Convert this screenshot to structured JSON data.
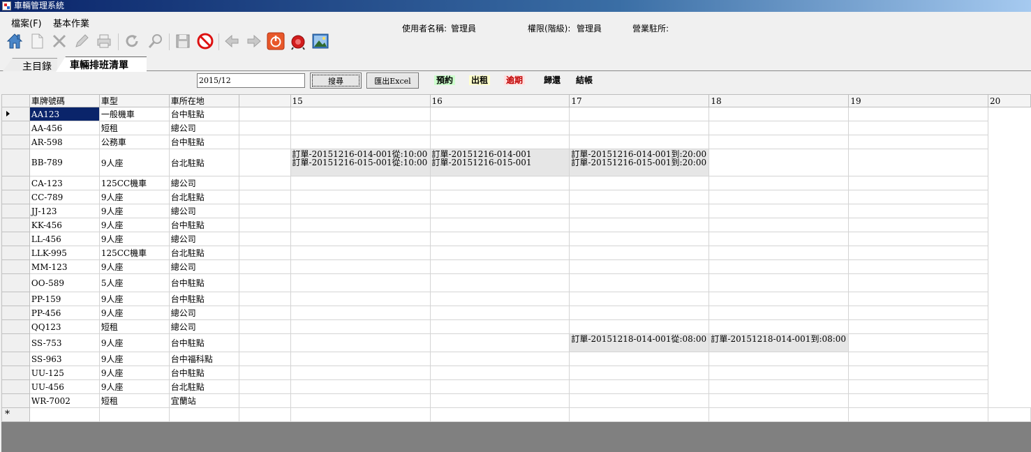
{
  "window": {
    "title": "車輛管理系統"
  },
  "menu": {
    "file": "檔案(F)",
    "basic": "基本作業"
  },
  "user_info": {
    "user_label": "使用者名稱:",
    "user_value": "管理員",
    "rights_label": "權限(階級):",
    "rights_value": "管理員",
    "office_label": "營業駐所:",
    "office_value": ""
  },
  "toolbar": {
    "icons": [
      "home-icon",
      "new-document-icon",
      "delete-icon",
      "edit-icon",
      "print-icon",
      "refresh-icon",
      "search-icon",
      "save-icon",
      "cancel-icon",
      "back-icon",
      "forward-icon",
      "power-icon",
      "alarm-icon",
      "image-icon"
    ]
  },
  "tabs": {
    "main": "主目錄",
    "schedule": "車輛排班清單"
  },
  "search": {
    "value": "2015/12",
    "search_button": "搜尋",
    "excel_button": "匯出Excel"
  },
  "legend": [
    {
      "label": "預約",
      "color": "#ccffcc",
      "text": "#000000"
    },
    {
      "label": "出租",
      "color": "#ffffcc",
      "text": "#000000"
    },
    {
      "label": "逾期",
      "color": "#ffe0e0",
      "text": "#c00000"
    },
    {
      "label": "歸還",
      "color": "#f0f0f0",
      "text": "#000000"
    },
    {
      "label": "結帳",
      "color": "#f0f0f0",
      "text": "#000000"
    }
  ],
  "grid": {
    "headers": [
      "車牌號碼",
      "車型",
      "車所在地",
      "",
      "15",
      "16",
      "17",
      "18",
      "19",
      "20"
    ],
    "rows": [
      {
        "plate": "AA123",
        "type": "一般機車",
        "loc": "台中駐點",
        "selected": true
      },
      {
        "plate": "AA-456",
        "type": "短租",
        "loc": "總公司"
      },
      {
        "plate": "AR-598",
        "type": "公務車",
        "loc": "台中駐點"
      },
      {
        "plate": "BB-789",
        "type": "9人座",
        "loc": "台北駐點",
        "tall": true,
        "d16": [
          "訂單-20151216-014-001從:10:00",
          "訂單-20151216-015-001從:10:00"
        ],
        "d17": [
          "訂單-20151216-014-001",
          "訂單-20151216-015-001"
        ],
        "d18": [
          "訂單-20151216-014-001到:20:00",
          "訂單-20151216-015-001到:20:00"
        ]
      },
      {
        "plate": "CA-123",
        "type": "125CC機車",
        "loc": "總公司"
      },
      {
        "plate": "CC-789",
        "type": "9人座",
        "loc": "台北駐點"
      },
      {
        "plate": "JJ-123",
        "type": "9人座",
        "loc": "總公司"
      },
      {
        "plate": "KK-456",
        "type": "9人座",
        "loc": "台中駐點"
      },
      {
        "plate": "LL-456",
        "type": "9人座",
        "loc": "總公司"
      },
      {
        "plate": "LLK-995",
        "type": "125CC機車",
        "loc": "台北駐點"
      },
      {
        "plate": "MM-123",
        "type": "9人座",
        "loc": "總公司"
      },
      {
        "plate": "OO-589",
        "type": "5人座",
        "loc": "台中駐點",
        "mid": true
      },
      {
        "plate": "PP-159",
        "type": "9人座",
        "loc": "台中駐點"
      },
      {
        "plate": "PP-456",
        "type": "9人座",
        "loc": "總公司"
      },
      {
        "plate": "QQ123",
        "type": "短租",
        "loc": "總公司"
      },
      {
        "plate": "SS-753",
        "type": "9人座",
        "loc": "台中駐點",
        "mid": true,
        "d18": [
          "訂單-20151218-014-001從:08:00"
        ],
        "d19": [
          "訂單-20151218-014-001到:08:00"
        ]
      },
      {
        "plate": "SS-963",
        "type": "9人座",
        "loc": "台中福科點"
      },
      {
        "plate": "UU-125",
        "type": "9人座",
        "loc": "台中駐點"
      },
      {
        "plate": "UU-456",
        "type": "9人座",
        "loc": "台北駐點"
      },
      {
        "plate": "WR-7002",
        "type": "短租",
        "loc": "宜蘭站"
      }
    ]
  }
}
